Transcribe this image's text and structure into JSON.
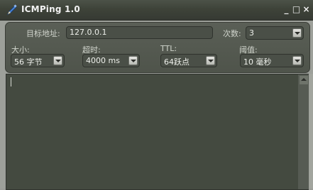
{
  "window": {
    "title": "ICMPing 1.0",
    "controls": {
      "minimize": "_",
      "maximize": "□",
      "close": "×"
    }
  },
  "form": {
    "target": {
      "label": "目标地址:",
      "value": "127.0.0.1"
    },
    "count": {
      "label": "次数:",
      "value": "3"
    },
    "size": {
      "label": "大小:",
      "value": "56 字节"
    },
    "timeout": {
      "label": "超时:",
      "value": "4000 ms"
    },
    "ttl": {
      "label": "TTL:",
      "value": "64跃点"
    },
    "threshold": {
      "label": "阈值:",
      "value": "10 毫秒"
    }
  },
  "icons": {
    "app": "pencil-icon",
    "select": "chevron-down-icon"
  },
  "colors": {
    "titlebar": "#3e4339",
    "panel": "#565b52",
    "output": "#444a40"
  }
}
